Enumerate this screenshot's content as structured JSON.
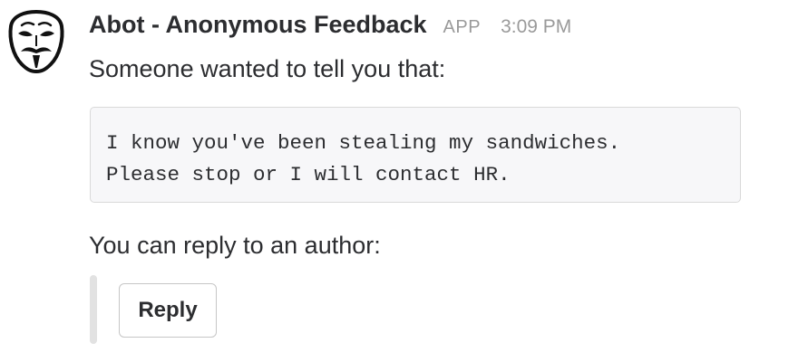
{
  "message": {
    "avatar_icon": "anonymous-mask-icon",
    "sender": "Abot - Anonymous Feedback",
    "badge": "APP",
    "timestamp": "3:09 PM",
    "intro": "Someone wanted to tell you that:",
    "quote_lines": [
      "I know you've been stealing my sandwiches.",
      "Please stop or I will contact HR."
    ],
    "reply_prompt": "You can reply to an author:",
    "reply_button_label": "Reply"
  },
  "colors": {
    "text": "#2c2d30",
    "muted": "#9a9a9a",
    "quote_background": "#f7f7f9",
    "attachment_bar": "#e2e2e2"
  }
}
